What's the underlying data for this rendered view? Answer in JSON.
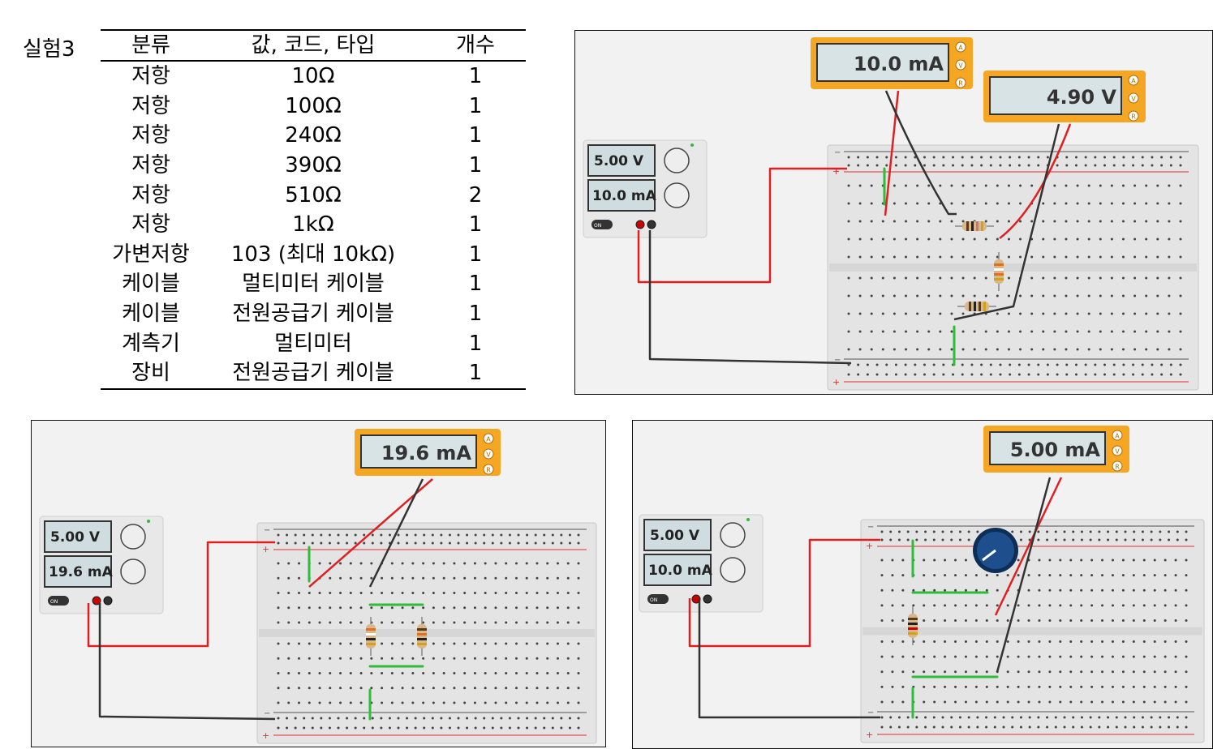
{
  "experiment_label": "실험3",
  "parts_table": {
    "headers": [
      "분류",
      "값, 코드, 타입",
      "개수"
    ],
    "rows": [
      [
        "저항",
        "10Ω",
        "1"
      ],
      [
        "저항",
        "100Ω",
        "1"
      ],
      [
        "저항",
        "240Ω",
        "1"
      ],
      [
        "저항",
        "390Ω",
        "1"
      ],
      [
        "저항",
        "510Ω",
        "2"
      ],
      [
        "저항",
        "1kΩ",
        "1"
      ],
      [
        "가변저항",
        "103 (최대 10kΩ)",
        "1"
      ],
      [
        "케이블",
        "멀티미터 케이블",
        "1"
      ],
      [
        "케이블",
        "전원공급기 케이블",
        "1"
      ],
      [
        "계측기",
        "멀티미터",
        "1"
      ],
      [
        "장비",
        "전원공급기 케이블",
        "1"
      ]
    ]
  },
  "circuits": {
    "top_right": {
      "supply_voltage": "5.00 V",
      "supply_current": "10.0 mA",
      "meter1_reading": "10.0 mA",
      "meter2_reading": "4.90 V"
    },
    "bottom_left": {
      "supply_voltage": "5.00 V",
      "supply_current": "19.6 mA",
      "meter_reading": "19.6 mA"
    },
    "bottom_right": {
      "supply_voltage": "5.00 V",
      "supply_current": "10.0 mA",
      "meter_reading": "5.00 mA"
    }
  },
  "meter_modes": [
    "A",
    "V",
    "R"
  ],
  "supply_on_label": "ON",
  "colors": {
    "meter_case": "#f5a623",
    "lcd": "#d8e3e6",
    "wire_red": "#e02020",
    "wire_black": "#333333",
    "jumper_green": "#2ebd3a",
    "rail_red": "#e03030",
    "pot_blue": "#1e4f8c"
  }
}
